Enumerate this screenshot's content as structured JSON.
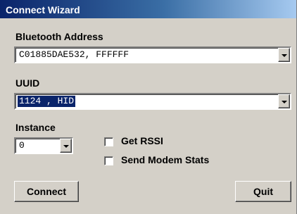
{
  "window": {
    "title": "Connect Wizard"
  },
  "bluetooth_address": {
    "label": "Bluetooth Address",
    "value": "C01885DAE532, FFFFFF"
  },
  "uuid": {
    "label": "UUID",
    "value": "1124 , HID"
  },
  "instance": {
    "label": "Instance",
    "value": "0"
  },
  "options": {
    "get_rssi_label": "Get RSSI",
    "send_modem_stats_label": "Send Modem Stats"
  },
  "buttons": {
    "connect": "Connect",
    "quit": "Quit"
  },
  "icons": {
    "dropdown": "chevron-down-icon"
  }
}
